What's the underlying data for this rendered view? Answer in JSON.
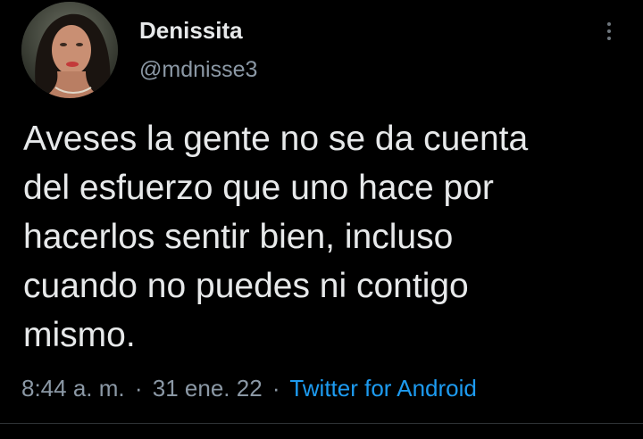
{
  "tweet": {
    "author": {
      "display_name": "Denissita",
      "handle": "@mdnisse3"
    },
    "text_lines": [
      "Aveses la gente no se da cuenta",
      "del esfuerzo que uno hace por",
      "hacerlos sentir bien, incluso",
      "cuando no puedes ni contigo",
      "mismo."
    ],
    "time": "8:44 a. m.",
    "separator": "·",
    "date": "31 ene. 22",
    "source": "Twitter for Android",
    "more_icon": "more-vertical-icon"
  },
  "colors": {
    "background": "#000000",
    "text": "#e7e9ea",
    "secondary": "#8b98a5",
    "link": "#1d9bf0"
  }
}
